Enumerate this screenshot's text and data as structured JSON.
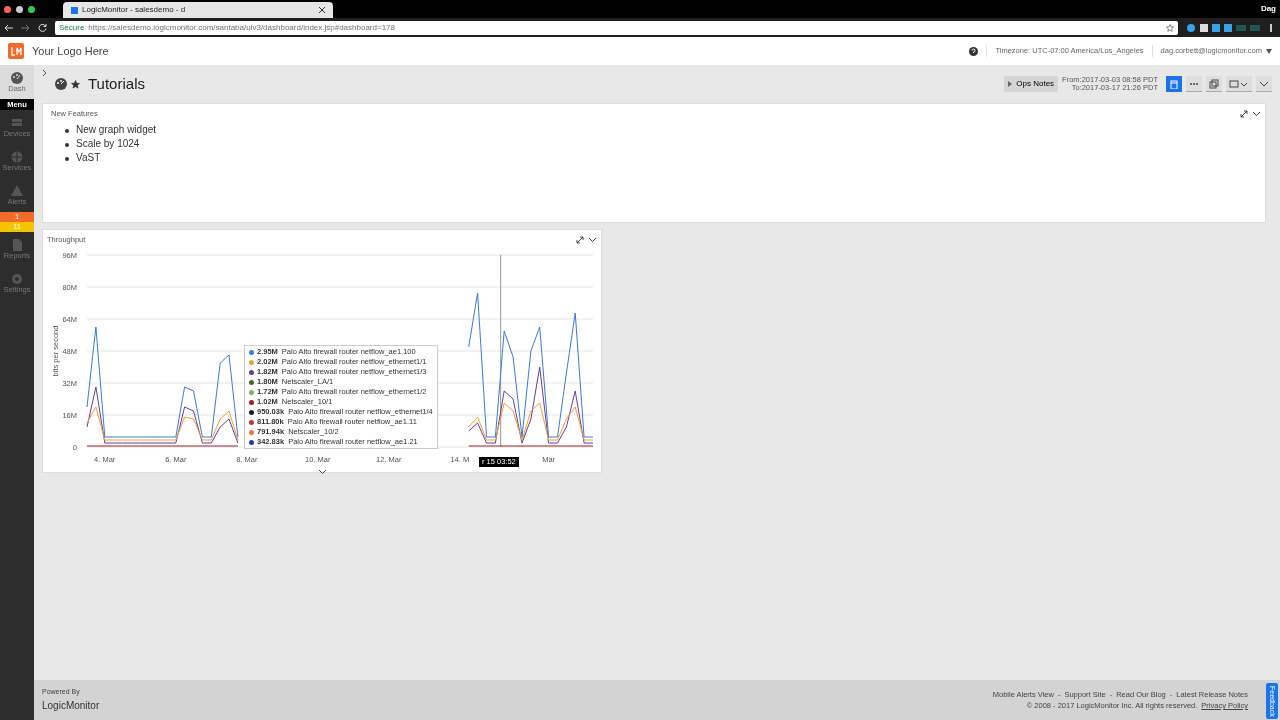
{
  "browser": {
    "tab_title": "LogicMonitor - salesdemo - d",
    "secure_label": "Secure",
    "url": "https://salesdemo.logicmonitor.com/santaba/uiv3/dashboard/index.jsp#dashboard=178",
    "profile": "Dag"
  },
  "header": {
    "logo_text": "Your Logo Here",
    "timezone": "Timezone: UTC-07:00 America/Los_Angeles",
    "user": "dag.corbett@logicmonitor.com"
  },
  "sidebar": {
    "menu_label": "Menu",
    "items": [
      {
        "kind": "dash",
        "label": "Dash",
        "selected": true
      },
      {
        "kind": "devices",
        "label": "Devices",
        "selected": false
      },
      {
        "kind": "services",
        "label": "Services",
        "selected": false
      },
      {
        "kind": "alerts",
        "label": "Alerts",
        "selected": false
      },
      {
        "kind": "reports",
        "label": "Reports",
        "selected": false
      },
      {
        "kind": "settings",
        "label": "Settings",
        "selected": false
      }
    ],
    "alert_counts": [
      {
        "count": "1",
        "color": "#f26b2a"
      },
      {
        "count": "11",
        "color": "#f5c400"
      }
    ]
  },
  "dashboard": {
    "title": "Tutorials",
    "favorite": true,
    "ops_notes": "Ops Notes",
    "from": "From:2017-03-03 08:58 PDT",
    "to": "To:2017-03-17 21:26 PDT",
    "toolbar": [
      {
        "kind": "calendar",
        "selected": true
      },
      {
        "kind": "dots",
        "selected": false
      },
      {
        "kind": "copy",
        "selected": false
      },
      {
        "kind": "fit",
        "selected": false
      },
      {
        "kind": "caret",
        "selected": false
      }
    ]
  },
  "text_widget": {
    "title": "New Features",
    "items": [
      "New graph widget",
      "Scale by 1024",
      "VaST"
    ]
  },
  "graph_widget": {
    "title": "Throughput",
    "chart_data": {
      "type": "line",
      "ylabel": "bits per second",
      "grid": true,
      "categories": [
        null,
        null,
        "4. Mar",
        null,
        null,
        null,
        null,
        null,
        null,
        null,
        "6. Mar",
        null,
        null,
        null,
        null,
        null,
        null,
        null,
        "8. Mar",
        null,
        null,
        null,
        null,
        null,
        null,
        null,
        "10. Mar",
        null,
        null,
        null,
        null,
        null,
        null,
        null,
        "12. Mar",
        null,
        null,
        null,
        null,
        null,
        null,
        null,
        "14. M",
        null,
        null,
        null,
        null,
        null,
        null,
        null,
        null,
        null,
        "Mar",
        null,
        null,
        null,
        null,
        null
      ],
      "series": [
        {
          "color": "#a02020",
          "values": [
            0.5,
            0.5,
            0.5,
            0.5,
            0.5,
            0.5,
            0.5,
            0.5,
            0.5,
            0.5,
            0.5,
            0.5,
            0.5,
            0.5,
            0.5,
            0.5,
            0.5,
            0.5,
            null,
            null,
            null,
            null,
            null,
            null,
            null,
            null,
            null,
            null,
            null,
            null,
            null,
            null,
            null,
            null,
            null,
            null,
            null,
            null,
            null,
            null,
            null,
            null,
            null,
            0.5,
            0.5,
            0.5,
            0.5,
            0.5,
            0.5,
            0.5,
            0.5,
            0.5,
            0.5,
            0.5,
            0.5,
            0.5,
            0.5,
            0.5
          ]
        },
        {
          "color": "#6a3d9a",
          "values": [
            10,
            30,
            2,
            2,
            2,
            2,
            2,
            2,
            2,
            2,
            2,
            20,
            18,
            2,
            2,
            10,
            14,
            2,
            null,
            null,
            null,
            null,
            null,
            null,
            null,
            null,
            null,
            null,
            null,
            null,
            null,
            null,
            null,
            null,
            null,
            null,
            null,
            null,
            null,
            null,
            null,
            null,
            null,
            8,
            12,
            2,
            2,
            28,
            24,
            2,
            14,
            40,
            2,
            2,
            10,
            28,
            2,
            2
          ]
        },
        {
          "color": "#f0a030",
          "values": [
            12,
            20,
            3.5,
            3.5,
            3.5,
            3.5,
            3.5,
            3.5,
            3.5,
            3.5,
            3.5,
            15,
            14,
            3.5,
            3.5,
            14,
            18,
            3.5,
            null,
            null,
            null,
            null,
            null,
            null,
            null,
            null,
            null,
            null,
            null,
            null,
            null,
            null,
            null,
            null,
            null,
            null,
            null,
            null,
            null,
            null,
            null,
            null,
            null,
            10,
            15,
            3.5,
            3.5,
            22,
            18,
            3.5,
            18,
            22,
            3.5,
            3.5,
            14,
            20,
            3.5,
            3.5
          ]
        },
        {
          "color": "#3a7bd5",
          "values": [
            20,
            60,
            5,
            5,
            5,
            5,
            5,
            5,
            5,
            5,
            5,
            30,
            28,
            5,
            5,
            42,
            46,
            5,
            null,
            null,
            null,
            null,
            null,
            null,
            null,
            null,
            null,
            null,
            null,
            null,
            null,
            null,
            null,
            null,
            null,
            null,
            null,
            null,
            null,
            null,
            null,
            null,
            null,
            50,
            77,
            5,
            5,
            58,
            45,
            5,
            48,
            60,
            5,
            5,
            37,
            67,
            5,
            5
          ]
        }
      ],
      "ylim": [
        0,
        96
      ],
      "yticks": [
        {
          "value": 0,
          "label": "0"
        },
        {
          "value": 16,
          "label": "16M"
        },
        {
          "value": 32,
          "label": "32M"
        },
        {
          "value": 48,
          "label": "48M"
        },
        {
          "value": 64,
          "label": "64M"
        },
        {
          "value": 80,
          "label": "80M"
        },
        {
          "value": 96,
          "label": "96M"
        }
      ]
    },
    "cursor_label": "r 15 03:52",
    "tooltip": [
      {
        "value": "2.95M",
        "name": "Palo Alto firewall router netflow_ae1.100",
        "color": "#3a7bd5"
      },
      {
        "value": "2.02M",
        "name": "Palo Alto firewall router netflow_ethernet1/1",
        "color": "#f0a030"
      },
      {
        "value": "1.82M",
        "name": "Palo Alto firewall router netflow_ethernet1/3",
        "color": "#6a3d9a"
      },
      {
        "value": "1.80M",
        "name": "Netscaler_LA/1",
        "color": "#3f6b2a"
      },
      {
        "value": "1.72M",
        "name": "Palo Alto firewall router netflow_ethernet1/2",
        "color": "#7ab55c"
      },
      {
        "value": "1.02M",
        "name": "Netscaler_10/1",
        "color": "#a02020"
      },
      {
        "value": "950.03k",
        "name": "Palo Alto firewall router netflow_ethernet1/4",
        "color": "#1a1a2e"
      },
      {
        "value": "811.80k",
        "name": "Palo Alto firewall router netflow_ae1.11",
        "color": "#c0392b"
      },
      {
        "value": "791.94k",
        "name": "Netscaler_10/2",
        "color": "#e8743b"
      },
      {
        "value": "342.83k",
        "name": "Palo Alto firewall router netflow_ae1.21",
        "color": "#1f3f9f"
      }
    ]
  },
  "footer": {
    "powered_by": "Powered By",
    "brand": "LogicMonitor",
    "links": [
      "Mobile Alerts View",
      "Support Site",
      "Read Our Blog",
      "Latest Release Notes"
    ],
    "separator": "-",
    "copyright": "© 2008 - 2017 LogicMonitor Inc. All rights reserved.",
    "privacy": "Privacy Policy",
    "feedback": "Feedback"
  }
}
